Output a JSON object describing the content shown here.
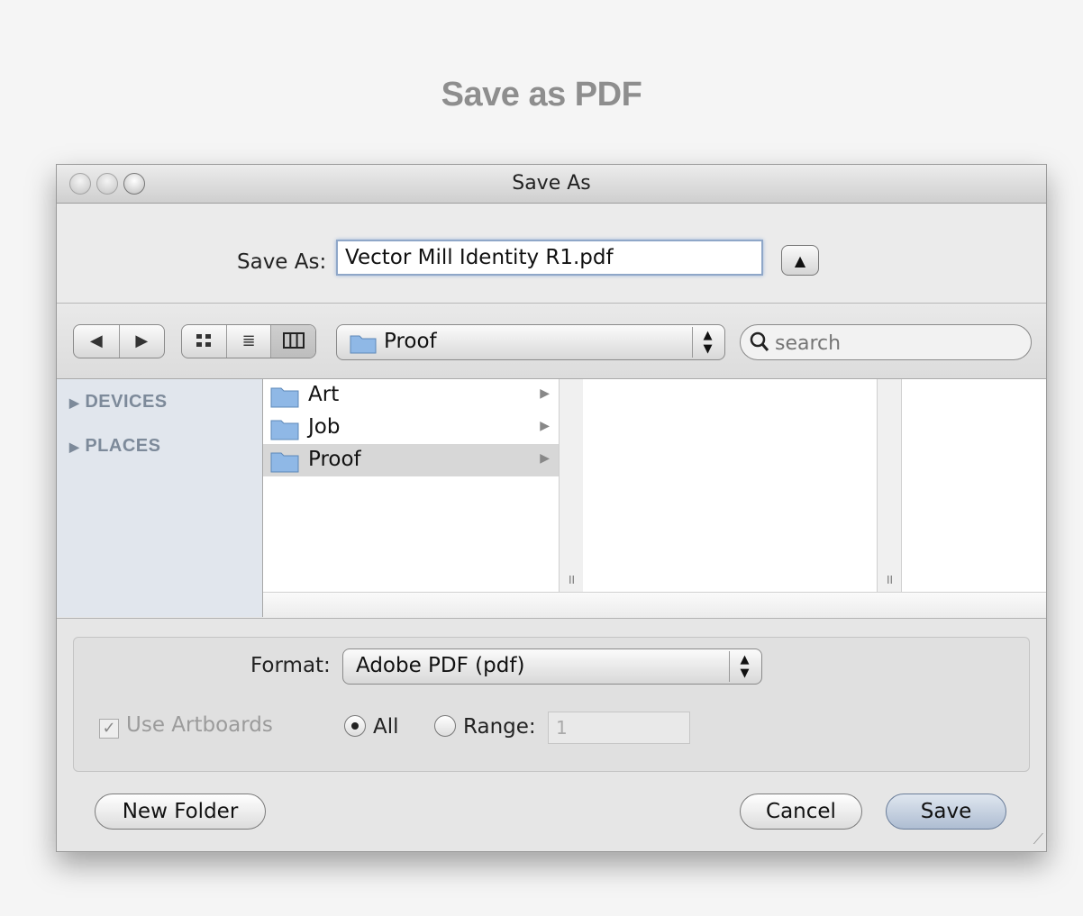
{
  "page": {
    "title": "Save as PDF"
  },
  "dialog": {
    "title": "Save As",
    "save_as": {
      "label": "Save As:",
      "value": "Vector Mill Identity R1.pdf"
    },
    "toolbar": {
      "path_folder": "Proof",
      "search_placeholder": "search"
    },
    "sidebar": {
      "sections": [
        "DEVICES",
        "PLACES"
      ]
    },
    "columns": {
      "column1": [
        {
          "name": "Art"
        },
        {
          "name": "Job"
        },
        {
          "name": "Proof"
        }
      ]
    },
    "options": {
      "format_label": "Format:",
      "format_value": "Adobe PDF (pdf)",
      "use_artboards_label": "Use Artboards",
      "use_artboards_checked": true,
      "use_artboards_enabled": false,
      "all_label": "All",
      "range_label": "Range:",
      "range_value": "1",
      "selected_range_mode": "All"
    },
    "buttons": {
      "new_folder": "New Folder",
      "cancel": "Cancel",
      "save": "Save"
    }
  }
}
